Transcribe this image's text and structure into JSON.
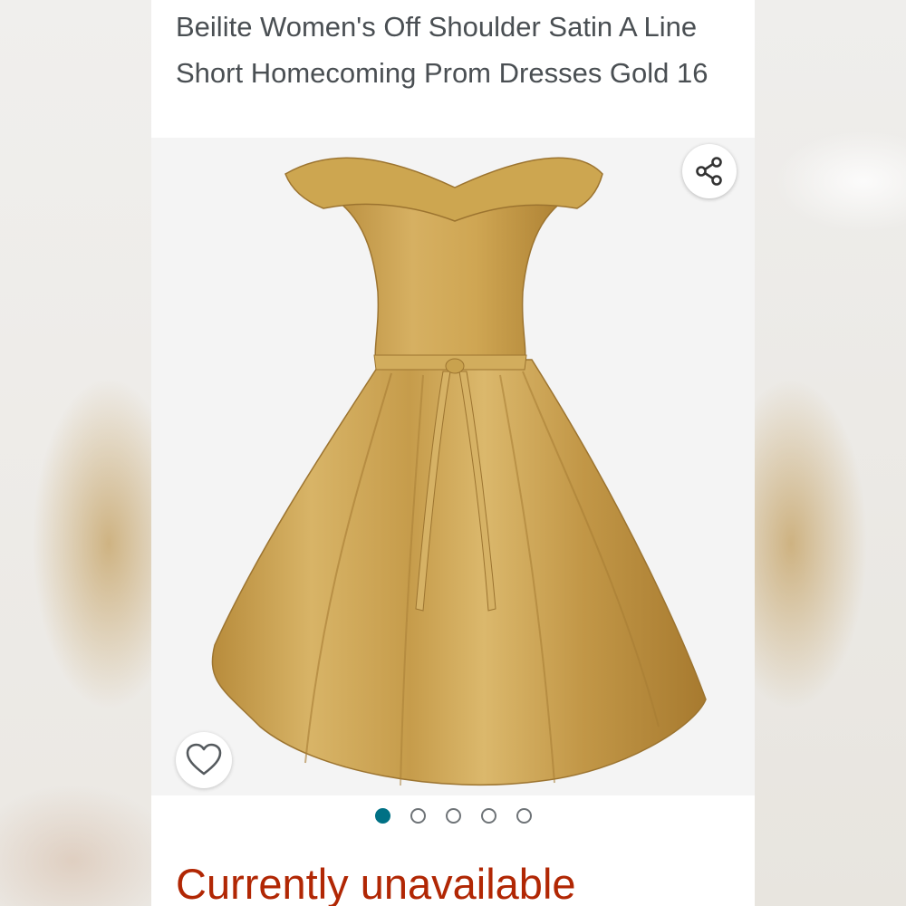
{
  "product": {
    "title": "Beilite Women's Off Shoulder Satin A Line Short Homecoming Prom Dresses Gold 16",
    "availability": "Currently unavailable"
  },
  "image_gallery": {
    "image_count": 5,
    "active_index": 0,
    "dress_color": "#c9a24e"
  },
  "icons": {
    "share": "share-icon",
    "wishlist": "heart-outline-icon"
  },
  "colors": {
    "availability_text": "#b12704",
    "active_dot": "#007185",
    "title_text": "#4a4f53"
  }
}
